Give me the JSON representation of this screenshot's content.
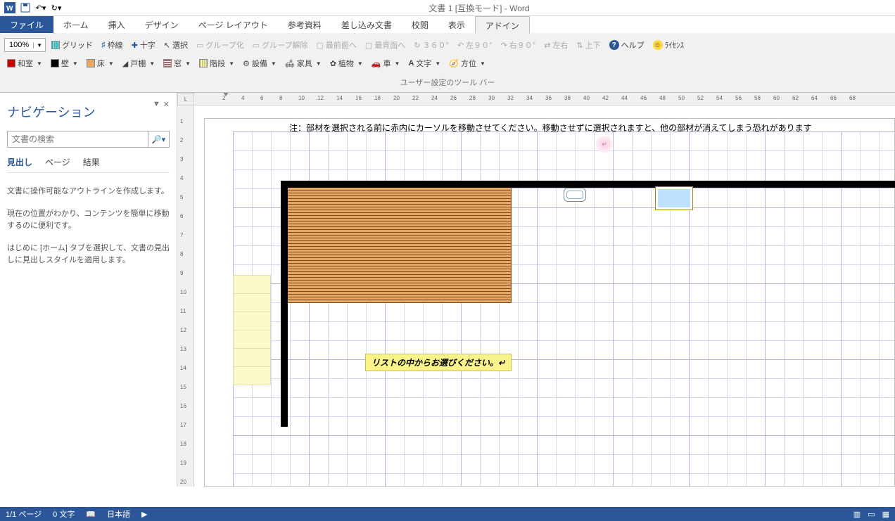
{
  "title": "文書 1 [互換モード] - Word",
  "tabs": {
    "file": "ファイル",
    "home": "ホーム",
    "insert": "挿入",
    "design": "デザイン",
    "layout": "ページ レイアウト",
    "ref": "参考資料",
    "mail": "差し込み文書",
    "review": "校閲",
    "view": "表示",
    "addin": "アドイン"
  },
  "zoom": "100%",
  "tb1": {
    "grid": "グリッド",
    "frame": "枠線",
    "cross": "十字",
    "select": "選択",
    "group": "グループ化",
    "ungroup": "グループ解除",
    "front": "最前面へ",
    "back": "最背面へ",
    "rot360": "３６０°",
    "left90": "左９０°",
    "right90": "右９０°",
    "lr": "左右",
    "ud": "上下",
    "help": "ヘルプ",
    "license": "ﾗｲｾﾝｽ"
  },
  "tb2": {
    "washitsu": "和室",
    "wall": "壁",
    "floor": "床",
    "door": "戸棚",
    "window": "窓",
    "stairs": "階段",
    "equip": "設備",
    "furn": "家具",
    "plant": "植物",
    "car": "車",
    "text": "文字",
    "compass": "方位"
  },
  "toolbar_label": "ユーザー設定のツール バー",
  "nav": {
    "title": "ナビゲーション",
    "placeholder": "文書の検索",
    "tab1": "見出し",
    "tab2": "ページ",
    "tab3": "結果",
    "p1": "文書に操作可能なアウトラインを作成します。",
    "p2": "現在の位置がわかり、コンテンツを簡単に移動するのに便利です。",
    "p3": "はじめに [ホーム] タブを選択して、文書の見出しに見出しスタイルを適用します。"
  },
  "doc": {
    "warn": "注：部材を選択される前に赤内にカーソルを移動させてください。移動させずに選択されますと、他の部材が消えてしまう恐れがあります",
    "callout": "リストの中からお選びください。↵"
  },
  "hticks": [
    2,
    4,
    6,
    8,
    10,
    12,
    14,
    16,
    18,
    20,
    22,
    24,
    26,
    28,
    30,
    32,
    34,
    36,
    38,
    40,
    42,
    44,
    46,
    48,
    50,
    52,
    54,
    56,
    58,
    60,
    62,
    64,
    66,
    68
  ],
  "vticks": [
    1,
    2,
    3,
    4,
    5,
    6,
    7,
    8,
    9,
    10,
    11,
    12,
    13,
    14,
    15,
    16,
    17,
    18,
    19,
    20
  ],
  "status": {
    "page": "1/1 ページ",
    "words": "0 文字",
    "lang": "日本語"
  }
}
